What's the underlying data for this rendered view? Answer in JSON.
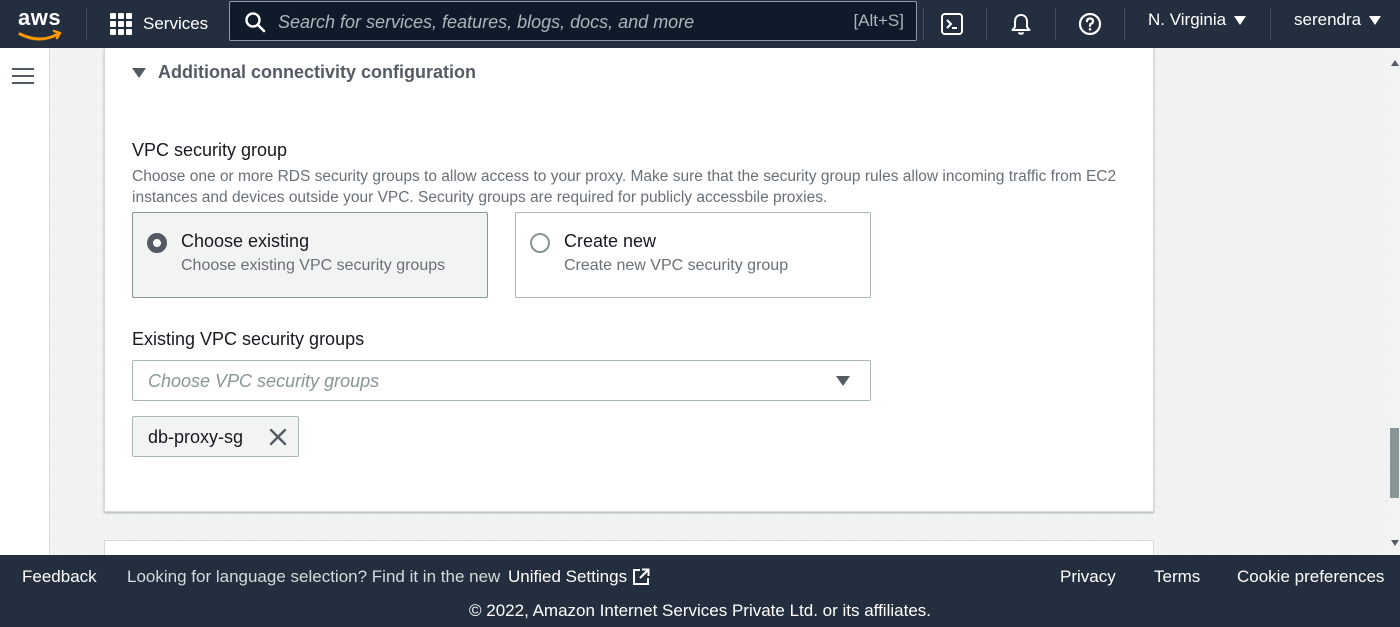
{
  "topnav": {
    "logo_text": "aws",
    "services_label": "Services",
    "search": {
      "placeholder": "Search for services, features, blogs, docs, and more",
      "shortcut": "[Alt+S]"
    },
    "icons": [
      "cloudshell-icon",
      "bell-icon",
      "help-icon"
    ],
    "region": "N. Virginia",
    "user": "serendra"
  },
  "section": {
    "title": "Additional connectivity configuration",
    "vpc_label": "VPC security group",
    "vpc_description": "Choose one or more RDS security groups to allow access to your proxy. Make sure that the security group rules allow incoming traffic from EC2 instances and devices outside your VPC. Security groups are required for publicly accessbile proxies.",
    "options": [
      {
        "title": "Choose existing",
        "subtitle": "Choose existing VPC security groups",
        "selected": true
      },
      {
        "title": "Create new",
        "subtitle": "Create new VPC security group",
        "selected": false
      }
    ],
    "existing_label": "Existing VPC security groups",
    "select_placeholder": "Choose VPC security groups",
    "tokens": [
      "db-proxy-sg"
    ]
  },
  "footer": {
    "feedback": "Feedback",
    "language_text": "Looking for language selection? Find it in the new",
    "unified_settings": "Unified Settings",
    "privacy": "Privacy",
    "terms": "Terms",
    "cookie": "Cookie preferences",
    "copyright": "© 2022, Amazon Internet Services Private Ltd. or its affiliates."
  },
  "colors": {
    "nav_bg": "#232f3e",
    "search_bg": "#0f1b2a",
    "page_bg": "#f2f3f3",
    "text_primary": "#16191f",
    "text_secondary": "#687078",
    "border": "#aab7b8"
  }
}
